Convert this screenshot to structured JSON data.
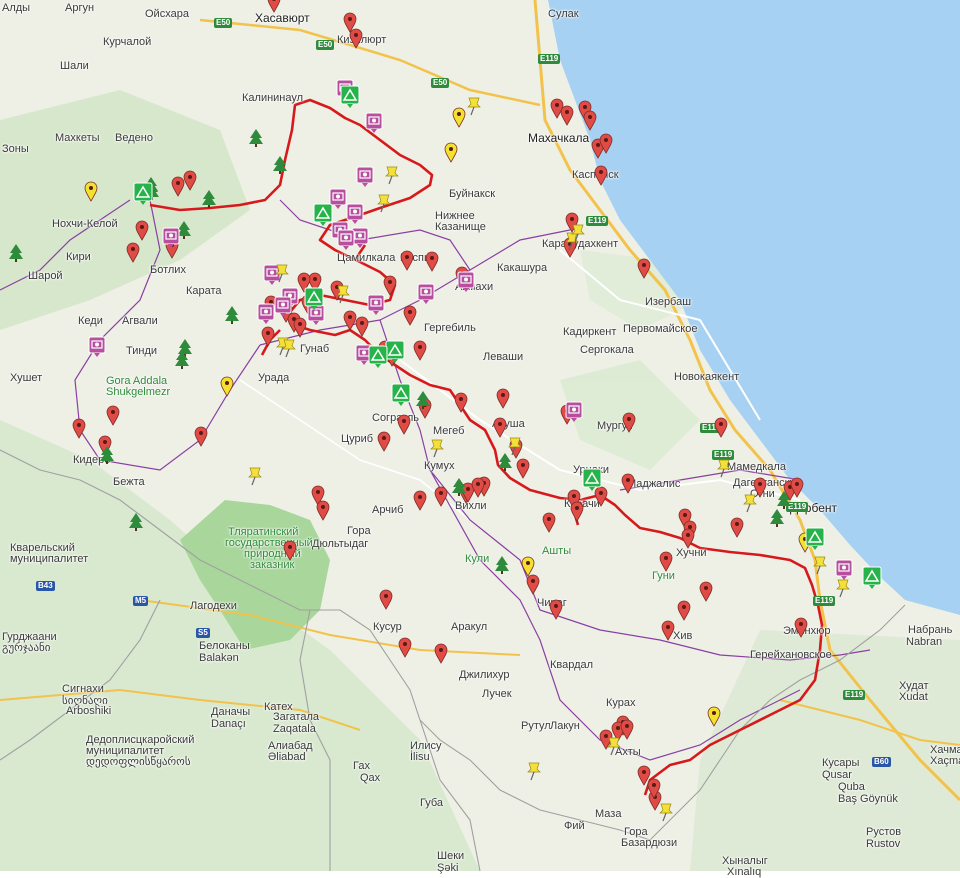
{
  "map": {
    "colors": {
      "land": "#eef0e6",
      "sea": "#a7d1f2",
      "forest": "#b9dcae",
      "reserve": "#a8d69b",
      "route": "#d7191c",
      "border": "#8a3fa3",
      "road": "#f2c24a",
      "pin_red": "#e04b45",
      "pin_yellow": "#f2e22f",
      "tree": "#2e8b3c",
      "camera": "#b84f9e",
      "camp": "#26b34a",
      "pushpin": "#f5e03a"
    },
    "labels": [
      {
        "t": "Алды"
      },
      {
        "t": "Аргун"
      },
      {
        "t": "Ойсхара"
      },
      {
        "t": "Хасавюрт"
      },
      {
        "t": "Сулак"
      },
      {
        "t": "Курчалой"
      },
      {
        "t": "Кизилюрт"
      },
      {
        "t": "Шали"
      },
      {
        "t": "Калининаул"
      },
      {
        "t": "Махкеты"
      },
      {
        "t": "Ведено"
      },
      {
        "t": "Махачкала"
      },
      {
        "t": "Зоны"
      },
      {
        "t": "Каспийск"
      },
      {
        "t": "Нохчи-Келой"
      },
      {
        "t": "Буйнакск"
      },
      {
        "t": "Нижнее"
      },
      {
        "t": "Казанище"
      },
      {
        "t": "Кири"
      },
      {
        "t": "Шарой"
      },
      {
        "t": "Ботлих"
      },
      {
        "t": "Цамилкала"
      },
      {
        "t": "Каспий"
      },
      {
        "t": "Карабудахкент"
      },
      {
        "t": "Какашура"
      },
      {
        "t": "Карата"
      },
      {
        "t": "Ахмахи"
      },
      {
        "t": "Изербаш"
      },
      {
        "t": "Кеди"
      },
      {
        "t": "Агвали"
      },
      {
        "t": "Гергебиль"
      },
      {
        "t": "Кадиркент"
      },
      {
        "t": "Первомайское"
      },
      {
        "t": "Хушет"
      },
      {
        "t": "Тинди"
      },
      {
        "t": "Гунаб"
      },
      {
        "t": "Леваши"
      },
      {
        "t": "Сергокала"
      },
      {
        "t": "Gora Addala"
      },
      {
        "t": "Shukgelmezr"
      },
      {
        "t": "Урада"
      },
      {
        "t": "Новокаякент"
      },
      {
        "t": "Согратль"
      },
      {
        "t": "Акуша"
      },
      {
        "t": "Мургук"
      },
      {
        "t": "Кидеро"
      },
      {
        "t": "Цуриб"
      },
      {
        "t": "Мегеб"
      },
      {
        "t": "Мамедкала"
      },
      {
        "t": "Урцаки"
      },
      {
        "t": "Кумух"
      },
      {
        "t": "Дагестанские"
      },
      {
        "t": "Огни"
      },
      {
        "t": "Бежта"
      },
      {
        "t": "Маджалис"
      },
      {
        "t": "Дербент"
      },
      {
        "t": "Вихли"
      },
      {
        "t": "Арчиб"
      },
      {
        "t": "Кубачи"
      },
      {
        "t": "Кварельский"
      },
      {
        "t": "муниципалитет"
      },
      {
        "t": "Гора"
      },
      {
        "t": "Дюльтыдаг"
      },
      {
        "t": "Хучни"
      },
      {
        "t": "Тляратинский"
      },
      {
        "t": "государственный"
      },
      {
        "t": "природный"
      },
      {
        "t": "заказник"
      },
      {
        "t": "Кули"
      },
      {
        "t": "Ашты"
      },
      {
        "t": "Гуни"
      },
      {
        "t": "Чираг"
      },
      {
        "t": "Лагодехи"
      },
      {
        "t": "Кусур"
      },
      {
        "t": "Аракул"
      },
      {
        "t": "Хив"
      },
      {
        "t": "Эминхюр"
      },
      {
        "t": "Набрань"
      },
      {
        "t": "Nabran"
      },
      {
        "t": "Гурджаани"
      },
      {
        "t": "გურჯაანი"
      },
      {
        "t": "Белоканы"
      },
      {
        "t": "Balakən"
      },
      {
        "t": "Квардал"
      },
      {
        "t": "Герейхановское"
      },
      {
        "t": "Сигнахи"
      },
      {
        "t": "სიღნაღი"
      },
      {
        "t": "Arboshiki"
      },
      {
        "t": "Катех"
      },
      {
        "t": "Загатала"
      },
      {
        "t": "Zaqatala"
      },
      {
        "t": "Джилихур"
      },
      {
        "t": "Лучек"
      },
      {
        "t": "Курах"
      },
      {
        "t": "Худат"
      },
      {
        "t": "Xudat"
      },
      {
        "t": "Даначы"
      },
      {
        "t": "Danaçı"
      },
      {
        "t": "Рутул"
      },
      {
        "t": "Лакун"
      },
      {
        "t": "Дедоплисцкаройский"
      },
      {
        "t": "муниципалитет"
      },
      {
        "t": "დედოფლისწყაროს"
      },
      {
        "t": "Алиабад"
      },
      {
        "t": "Əliabad"
      },
      {
        "t": "Илису"
      },
      {
        "t": "İlisu"
      },
      {
        "t": "Ахты"
      },
      {
        "t": "Хачмас"
      },
      {
        "t": "Xaçmaz"
      },
      {
        "t": "Гах"
      },
      {
        "t": "Qax"
      },
      {
        "t": "Кусары"
      },
      {
        "t": "Qusar"
      },
      {
        "t": "Губа"
      },
      {
        "t": "Quba"
      },
      {
        "t": "Baş Göynük"
      },
      {
        "t": "Маза"
      },
      {
        "t": "Фий"
      },
      {
        "t": "Гора"
      },
      {
        "t": "Базардюзи"
      },
      {
        "t": "Рустов"
      },
      {
        "t": "Rustov"
      },
      {
        "t": "Шеки"
      },
      {
        "t": "Şəki"
      },
      {
        "t": "Хыналыг"
      },
      {
        "t": "Xınalıq"
      }
    ],
    "shields": [
      {
        "t": "E50",
        "k": "e"
      },
      {
        "t": "E50",
        "k": "e"
      },
      {
        "t": "E50",
        "k": "e"
      },
      {
        "t": "E119",
        "k": "e"
      },
      {
        "t": "E119",
        "k": "e"
      },
      {
        "t": "E119",
        "k": "e"
      },
      {
        "t": "E119",
        "k": "e"
      },
      {
        "t": "E119",
        "k": "e"
      },
      {
        "t": "E119",
        "k": "e"
      },
      {
        "t": "E119",
        "k": "e"
      },
      {
        "t": "B60",
        "k": "m"
      },
      {
        "t": "B43",
        "k": "m"
      },
      {
        "t": "M5",
        "k": "m"
      },
      {
        "t": "S5",
        "k": "m"
      }
    ]
  }
}
